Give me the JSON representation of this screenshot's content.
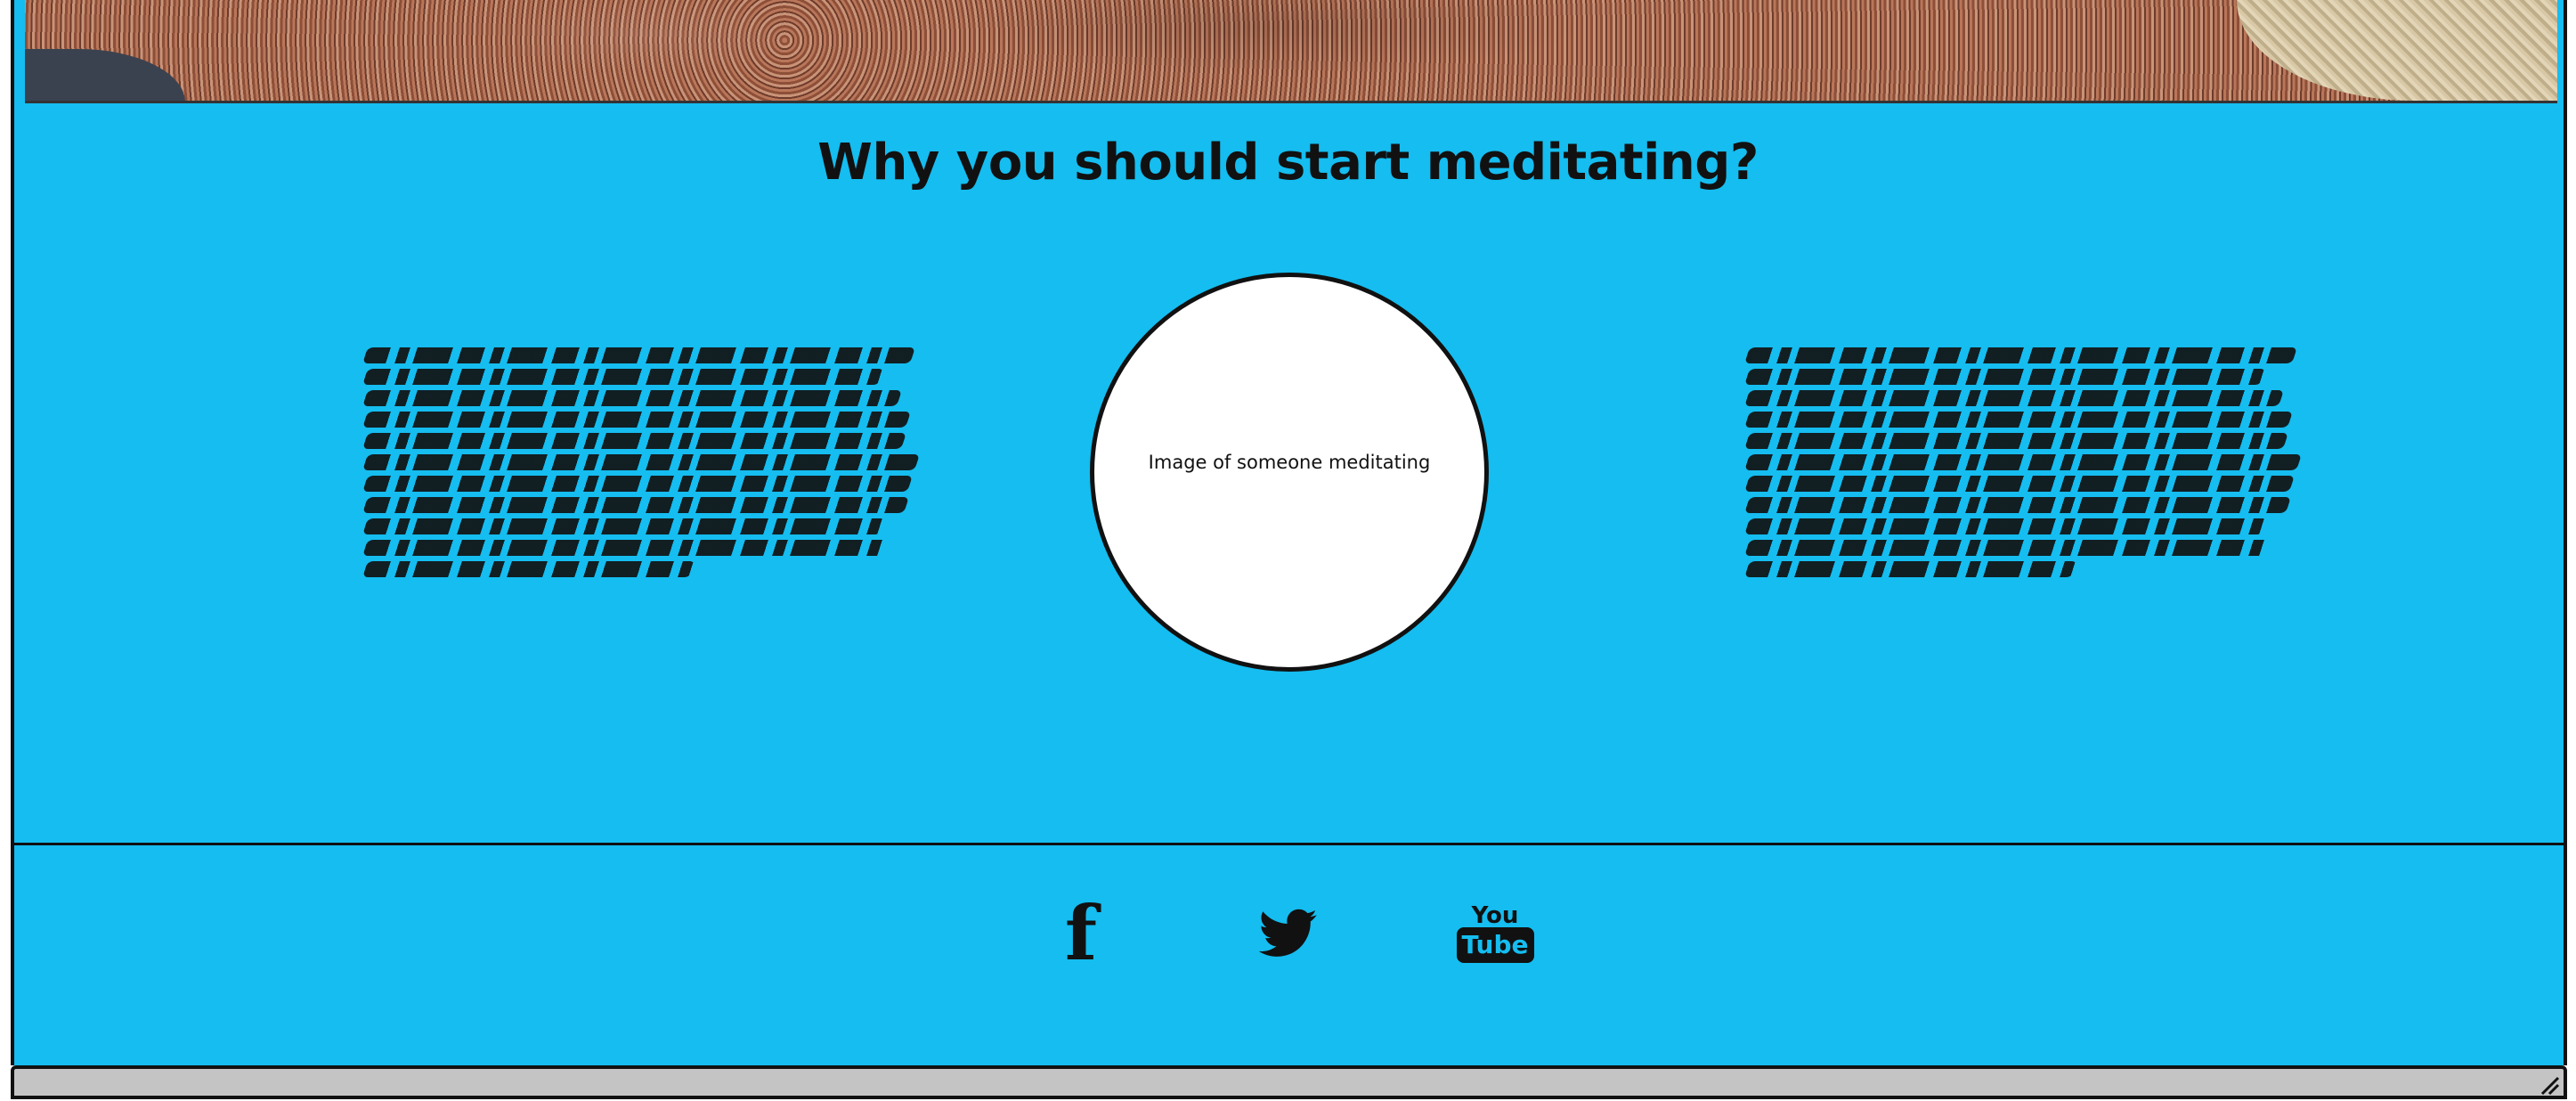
{
  "hero": {
    "image_name": "rock-landscape-banner"
  },
  "section": {
    "title": "Why you should start meditating?",
    "left_text": {
      "line_count": 11
    },
    "image_placeholder": "Image of someone meditating",
    "right_text": {
      "line_count": 11
    }
  },
  "footer": {
    "social": [
      {
        "name": "facebook-icon",
        "glyph": "f"
      },
      {
        "name": "twitter-icon"
      },
      {
        "name": "youtube-icon",
        "you": "You",
        "tube": "Tube"
      }
    ]
  },
  "colors": {
    "background": "#15bdf0",
    "ink": "#111111",
    "circle_fill": "#ffffff",
    "bar": "#c4c4c4"
  }
}
